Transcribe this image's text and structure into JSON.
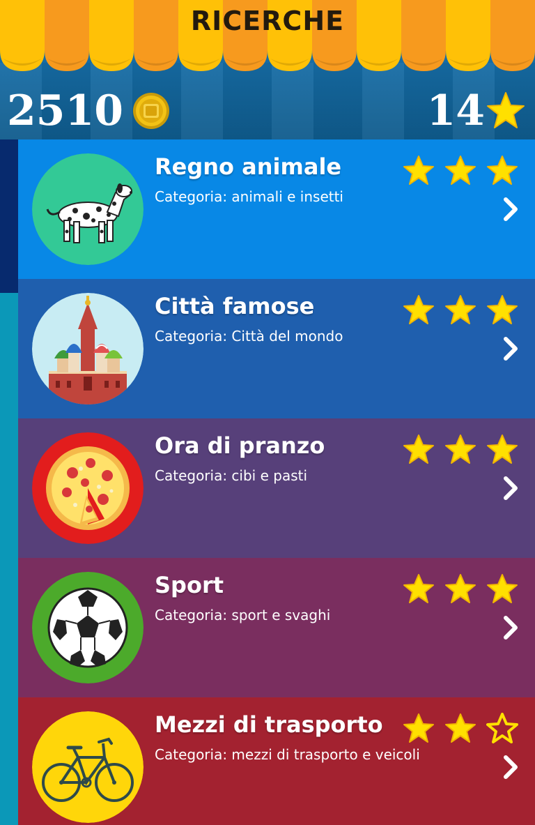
{
  "header": {
    "title": "RICERCHE",
    "coins": "2510",
    "stars": "14",
    "coin_icon": "coin-icon",
    "star_icon": "star-icon"
  },
  "colors": {
    "awning_yellow": "#ffc107",
    "awning_orange": "#f79a1e",
    "star": "#ffe000",
    "row_blue": "#0888e6",
    "row_dark_blue": "#1f5fae",
    "row_purple": "#57407a",
    "row_plum": "#7a2e5f",
    "row_red": "#a32230"
  },
  "categories": [
    {
      "title": "Regno animale",
      "subtitle": "Categoria: animali e insetti",
      "icon": "dalmatian-dog-icon",
      "stars_earned": 3,
      "stars_max": 3,
      "color": "#0888e6"
    },
    {
      "title": "Città famose",
      "subtitle": "Categoria: Città del mondo",
      "icon": "st-basils-cathedral-icon",
      "stars_earned": 3,
      "stars_max": 3,
      "color": "#1f5fae"
    },
    {
      "title": "Ora di pranzo",
      "subtitle": "Categoria: cibi e pasti",
      "icon": "pizza-icon",
      "stars_earned": 3,
      "stars_max": 3,
      "color": "#57407a"
    },
    {
      "title": "Sport",
      "subtitle": "Categoria: sport e svaghi",
      "icon": "soccer-ball-icon",
      "stars_earned": 3,
      "stars_max": 3,
      "color": "#7a2e5f"
    },
    {
      "title": "Mezzi di trasporto",
      "subtitle": "Categoria: mezzi di trasporto e veicoli",
      "icon": "bicycle-icon",
      "stars_earned": 2,
      "stars_max": 3,
      "color": "#a32230"
    }
  ]
}
